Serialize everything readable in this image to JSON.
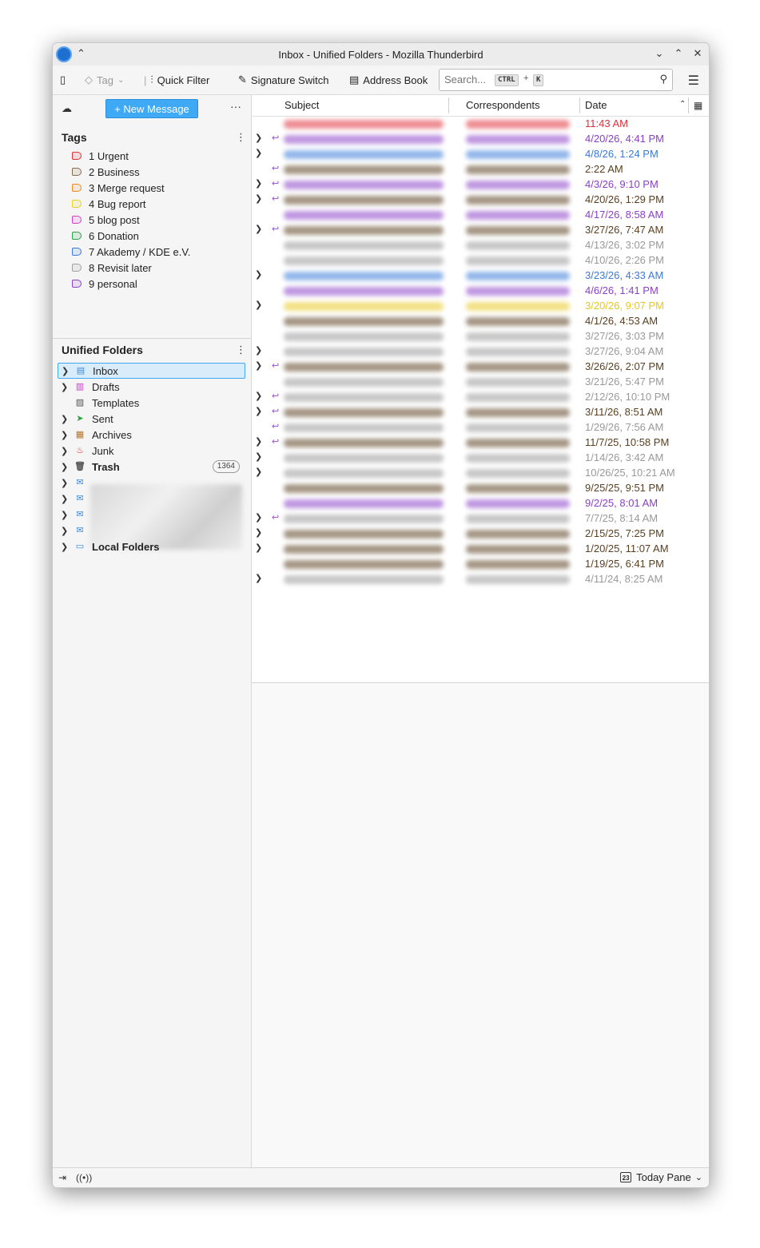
{
  "window": {
    "title": "Inbox - Unified Folders - Mozilla Thunderbird",
    "controls": {
      "minimize": "⌄",
      "maximize": "⌃",
      "close": "✕",
      "keep_above": "⌃"
    }
  },
  "toolbar": {
    "tag_label": "Tag",
    "quick_filter_label": "Quick Filter",
    "signature_switch_label": "Signature Switch",
    "address_book_label": "Address Book",
    "search": {
      "placeholder": "Search...",
      "shortcut_mod": "CTRL",
      "shortcut_plus": "+",
      "shortcut_key": "K"
    },
    "icons": {
      "folder_pane": "sidebar-toggle-icon",
      "tag": "tag-icon",
      "quick_filter": "filter-icon",
      "signature": "signature-icon",
      "address_book": "address-book-icon",
      "search": "search-icon",
      "menu": "hamburger-menu-icon"
    }
  },
  "sidebar": {
    "new_message_label": "+ New Message",
    "more_label": "···",
    "tags_title": "Tags",
    "tags": [
      {
        "label": "1 Urgent",
        "color": "#e0303a"
      },
      {
        "label": "2 Business",
        "color": "#8a6a4a"
      },
      {
        "label": "3 Merge request",
        "color": "#f08a20"
      },
      {
        "label": "4 Bug report",
        "color": "#e8d020"
      },
      {
        "label": "5 blog post",
        "color": "#d040c8"
      },
      {
        "label": "6 Donation",
        "color": "#2aa040"
      },
      {
        "label": "7 Akademy / KDE e.V.",
        "color": "#3a7ad8"
      },
      {
        "label": "8 Revisit later",
        "color": "#a0a0a0"
      },
      {
        "label": "9 personal",
        "color": "#8a40c8"
      }
    ],
    "unified_title": "Unified Folders",
    "folders": [
      {
        "label": "Inbox",
        "icon": "inbox-icon",
        "color": "#3a8ad8",
        "twisty": true,
        "selected": true,
        "bold": false
      },
      {
        "label": "Drafts",
        "icon": "drafts-icon",
        "color": "#c040c8",
        "twisty": true,
        "selected": false,
        "bold": false
      },
      {
        "label": "Templates",
        "icon": "templates-icon",
        "color": "#555555",
        "twisty": false,
        "selected": false,
        "bold": false
      },
      {
        "label": "Sent",
        "icon": "sent-icon",
        "color": "#2aa040",
        "twisty": true,
        "selected": false,
        "bold": false
      },
      {
        "label": "Archives",
        "icon": "archives-icon",
        "color": "#b07830",
        "twisty": true,
        "selected": false,
        "bold": false
      },
      {
        "label": "Junk",
        "icon": "junk-icon",
        "color": "#e03030",
        "twisty": true,
        "selected": false,
        "bold": false
      },
      {
        "label": "Trash",
        "icon": "trash-icon",
        "color": "#555555",
        "twisty": true,
        "selected": false,
        "bold": true,
        "count": "1364"
      }
    ],
    "local_folders_label": "Local Folders"
  },
  "thread": {
    "columns": {
      "subject": "Subject",
      "correspondents": "Correspondents",
      "date": "Date"
    },
    "rows": [
      {
        "twisty": false,
        "reply": false,
        "date": "11:43 AM",
        "color": "#e0303a"
      },
      {
        "twisty": true,
        "reply": true,
        "date": "4/20/26, 4:41 PM",
        "color": "#8a40c8"
      },
      {
        "twisty": true,
        "reply": false,
        "date": "4/8/26, 1:24 PM",
        "color": "#3a7ad8"
      },
      {
        "twisty": false,
        "reply": true,
        "date": "2:22 AM",
        "color": "#5a4020"
      },
      {
        "twisty": true,
        "reply": true,
        "date": "4/3/26, 9:10 PM",
        "color": "#8a40c8"
      },
      {
        "twisty": true,
        "reply": true,
        "date": "4/20/26, 1:29 PM",
        "color": "#5a4020"
      },
      {
        "twisty": false,
        "reply": false,
        "date": "4/17/26, 8:58 AM",
        "color": "#8a40c8"
      },
      {
        "twisty": true,
        "reply": true,
        "date": "3/27/26, 7:47 AM",
        "color": "#5a4020"
      },
      {
        "twisty": false,
        "reply": false,
        "date": "4/13/26, 3:02 PM",
        "color": "#999999"
      },
      {
        "twisty": false,
        "reply": false,
        "date": "4/10/26, 2:26 PM",
        "color": "#999999"
      },
      {
        "twisty": true,
        "reply": false,
        "date": "3/23/26, 4:33 AM",
        "color": "#3a7ad8"
      },
      {
        "twisty": false,
        "reply": false,
        "date": "4/6/26, 1:41 PM",
        "color": "#8a40c8"
      },
      {
        "twisty": true,
        "reply": false,
        "date": "3/20/26, 9:07 PM",
        "color": "#e8c820"
      },
      {
        "twisty": false,
        "reply": false,
        "date": "4/1/26, 4:53 AM",
        "color": "#5a4020"
      },
      {
        "twisty": false,
        "reply": false,
        "date": "3/27/26, 3:03 PM",
        "color": "#999999"
      },
      {
        "twisty": true,
        "reply": false,
        "date": "3/27/26, 9:04 AM",
        "color": "#999999"
      },
      {
        "twisty": true,
        "reply": true,
        "date": "3/26/26, 2:07 PM",
        "color": "#5a4020"
      },
      {
        "twisty": false,
        "reply": false,
        "date": "3/21/26, 5:47 PM",
        "color": "#999999"
      },
      {
        "twisty": true,
        "reply": true,
        "date": "2/12/26, 10:10 PM",
        "color": "#999999"
      },
      {
        "twisty": true,
        "reply": true,
        "date": "3/11/26, 8:51 AM",
        "color": "#5a4020"
      },
      {
        "twisty": false,
        "reply": true,
        "date": "1/29/26, 7:56 AM",
        "color": "#999999"
      },
      {
        "twisty": true,
        "reply": true,
        "date": "11/7/25, 10:58 PM",
        "color": "#5a4020"
      },
      {
        "twisty": true,
        "reply": false,
        "date": "1/14/26, 3:42 AM",
        "color": "#999999"
      },
      {
        "twisty": true,
        "reply": false,
        "date": "10/26/25, 10:21 AM",
        "color": "#999999"
      },
      {
        "twisty": false,
        "reply": false,
        "date": "9/25/25, 9:51 PM",
        "color": "#5a4020"
      },
      {
        "twisty": false,
        "reply": false,
        "date": "9/2/25, 8:01 AM",
        "color": "#8a40c8"
      },
      {
        "twisty": true,
        "reply": true,
        "date": "7/7/25, 8:14 AM",
        "color": "#999999"
      },
      {
        "twisty": true,
        "reply": false,
        "date": "2/15/25, 7:25 PM",
        "color": "#5a4020"
      },
      {
        "twisty": true,
        "reply": false,
        "date": "1/20/25, 11:07 AM",
        "color": "#5a4020"
      },
      {
        "twisty": false,
        "reply": false,
        "date": "1/19/25, 6:41 PM",
        "color": "#5a4020"
      },
      {
        "twisty": true,
        "reply": false,
        "date": "4/11/24, 8:25 AM",
        "color": "#999999"
      }
    ]
  },
  "statusbar": {
    "today_pane_label": "Today Pane",
    "calendar_day": "23"
  }
}
